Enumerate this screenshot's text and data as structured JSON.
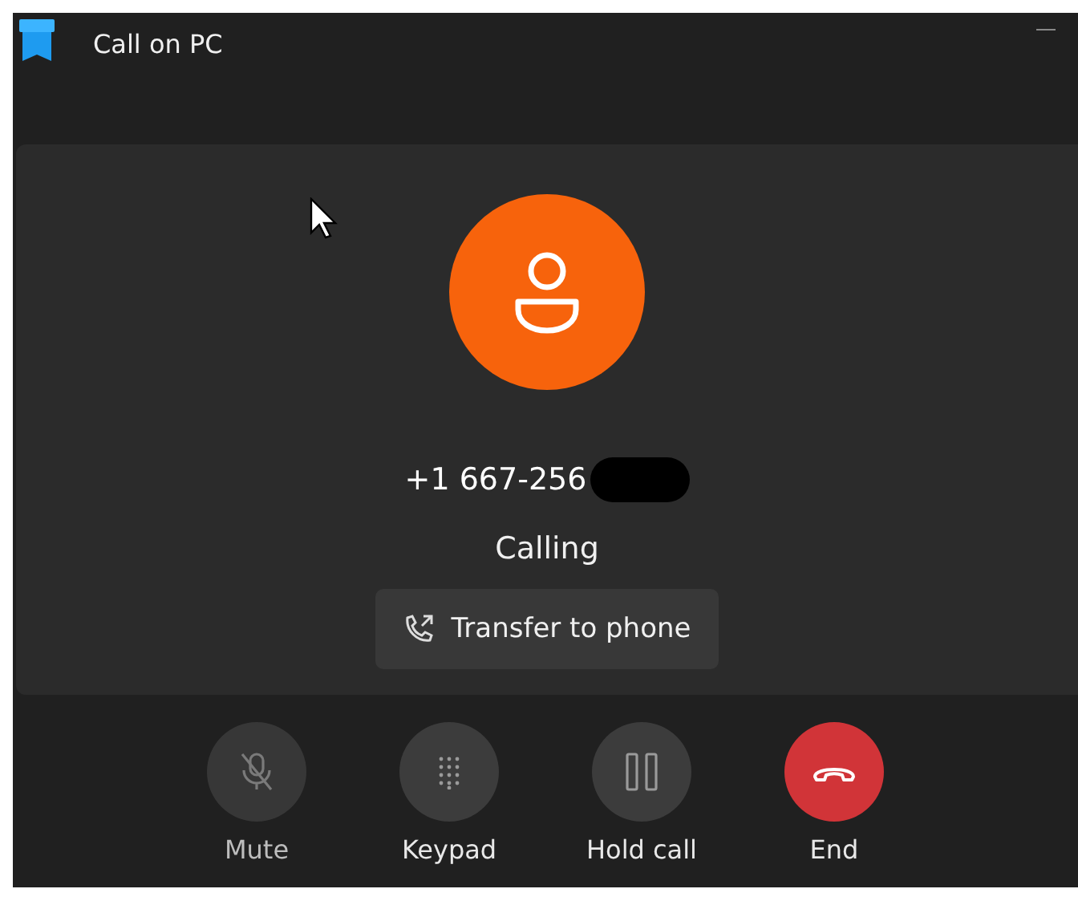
{
  "window": {
    "title": "Call on PC"
  },
  "contact": {
    "number": "+1 667-256",
    "status": "Calling"
  },
  "transfer_button": {
    "label": "Transfer to phone"
  },
  "controls": [
    {
      "kind": "mute",
      "label": "Mute",
      "disabled": true
    },
    {
      "kind": "keypad",
      "label": "Keypad",
      "disabled": false
    },
    {
      "kind": "hold",
      "label": "Hold call",
      "disabled": false
    },
    {
      "kind": "end",
      "label": "End",
      "disabled": false
    }
  ]
}
